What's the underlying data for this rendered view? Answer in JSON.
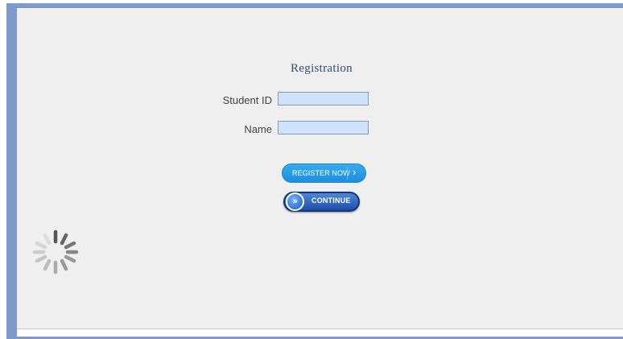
{
  "form": {
    "title": "Registration",
    "student_id_label": "Student ID",
    "name_label": "Name",
    "student_id_value": "",
    "name_value": ""
  },
  "buttons": {
    "register_now": "REGISTER NOW",
    "register_now_icon": "chevron-right-icon",
    "continue": "CONTINUE",
    "continue_icon": "double-chevron-right-icon"
  },
  "colors": {
    "frame": "#7d9acb",
    "panel": "#efefef",
    "input_fill": "#cfe1fb",
    "register_button": "#2a9ce8",
    "continue_button": "#1d4fa8"
  },
  "loading": {
    "icon": "spinner-icon"
  }
}
